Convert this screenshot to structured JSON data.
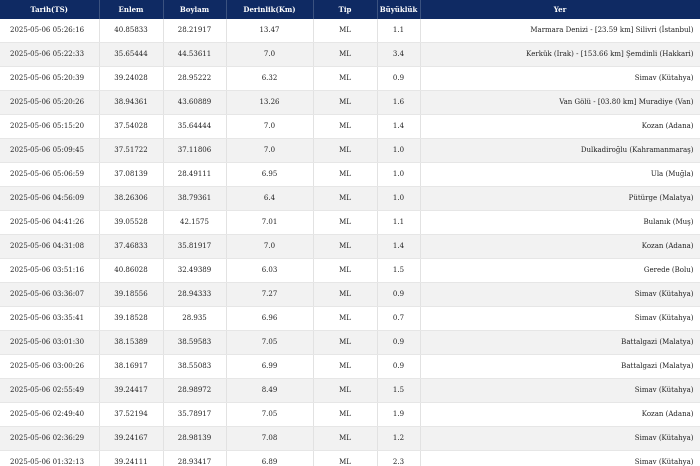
{
  "table": {
    "headers": [
      "Tarih(TS)",
      "Enlem",
      "Boylam",
      "Derinlik(Km)",
      "Tip",
      "Büyüklük",
      "Yer"
    ],
    "rows": [
      [
        "2025-05-06 05:26:16",
        "40.85833",
        "28.21917",
        "13.47",
        "ML",
        "1.1",
        "Marmara Denizi - [23.59 km] Silivri (İstanbul)"
      ],
      [
        "2025-05-06 05:22:33",
        "35.65444",
        "44.53611",
        "7.0",
        "ML",
        "3.4",
        "Kerkük (Irak) - [153.66 km] Şemdinli (Hakkari)"
      ],
      [
        "2025-05-06 05:20:39",
        "39.24028",
        "28.95222",
        "6.32",
        "ML",
        "0.9",
        "Simav (Kütahya)"
      ],
      [
        "2025-05-06 05:20:26",
        "38.94361",
        "43.60889",
        "13.26",
        "ML",
        "1.6",
        "Van Gölü - [03.80 km] Muradiye (Van)"
      ],
      [
        "2025-05-06 05:15:20",
        "37.54028",
        "35.64444",
        "7.0",
        "ML",
        "1.4",
        "Kozan (Adana)"
      ],
      [
        "2025-05-06 05:09:45",
        "37.51722",
        "37.11806",
        "7.0",
        "ML",
        "1.0",
        "Dulkadiroğlu (Kahramanmaraş)"
      ],
      [
        "2025-05-06 05:06:59",
        "37.08139",
        "28.49111",
        "6.95",
        "ML",
        "1.0",
        "Ula (Muğla)"
      ],
      [
        "2025-05-06 04:56:09",
        "38.26306",
        "38.79361",
        "6.4",
        "ML",
        "1.0",
        "Pütürge (Malatya)"
      ],
      [
        "2025-05-06 04:41:26",
        "39.05528",
        "42.1575",
        "7.01",
        "ML",
        "1.1",
        "Bulanık (Muş)"
      ],
      [
        "2025-05-06 04:31:08",
        "37.46833",
        "35.81917",
        "7.0",
        "ML",
        "1.4",
        "Kozan (Adana)"
      ],
      [
        "2025-05-06 03:51:16",
        "40.86028",
        "32.49389",
        "6.03",
        "ML",
        "1.5",
        "Gerede (Bolu)"
      ],
      [
        "2025-05-06 03:36:07",
        "39.18556",
        "28.94333",
        "7.27",
        "ML",
        "0.9",
        "Simav (Kütahya)"
      ],
      [
        "2025-05-06 03:35:41",
        "39.18528",
        "28.935",
        "6.96",
        "ML",
        "0.7",
        "Simav (Kütahya)"
      ],
      [
        "2025-05-06 03:01:30",
        "38.15389",
        "38.59583",
        "7.05",
        "ML",
        "0.9",
        "Battalgazi (Malatya)"
      ],
      [
        "2025-05-06 03:00:26",
        "38.16917",
        "38.55083",
        "6.99",
        "ML",
        "0.9",
        "Battalgazi (Malatya)"
      ],
      [
        "2025-05-06 02:55:49",
        "39.24417",
        "28.98972",
        "8.49",
        "ML",
        "1.5",
        "Simav (Kütahya)"
      ],
      [
        "2025-05-06 02:49:40",
        "37.52194",
        "35.78917",
        "7.05",
        "ML",
        "1.9",
        "Kozan (Adana)"
      ],
      [
        "2025-05-06 02:36:29",
        "39.24167",
        "28.98139",
        "7.08",
        "ML",
        "1.2",
        "Simav (Kütahya)"
      ],
      [
        "2025-05-06 01:32:13",
        "39.24111",
        "28.93417",
        "6.89",
        "ML",
        "2.3",
        "Simav (Kütahya)"
      ]
    ]
  },
  "colors": {
    "header_bg": "#0f2a63",
    "header_text": "#ffffff",
    "row_alt_bg": "#f2f2f2"
  }
}
